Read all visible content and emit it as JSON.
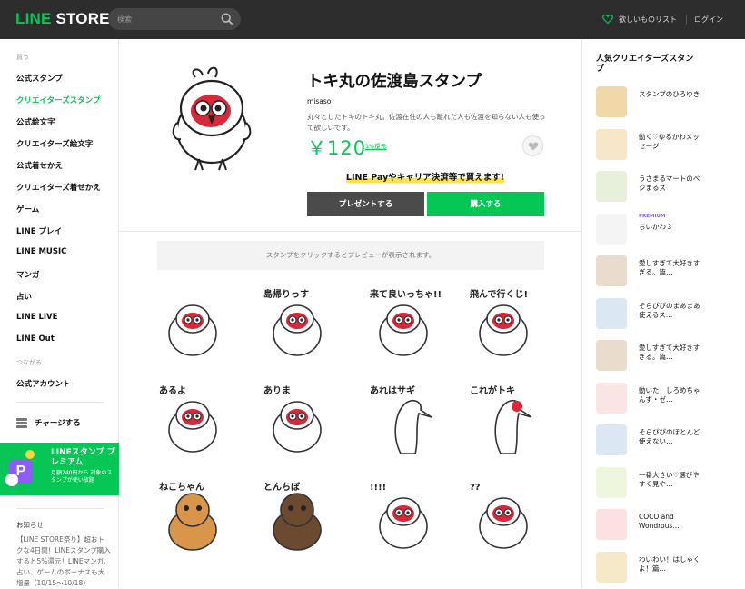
{
  "header": {
    "logo_line": "LINE",
    "logo_store": "STORE",
    "search_placeholder": "検索",
    "wishlist": "欲しいものリスト",
    "login": "ログイン"
  },
  "sidebar": {
    "section_buy": "買う",
    "items": [
      {
        "label": "公式スタンプ"
      },
      {
        "label": "クリエイターズスタンプ"
      },
      {
        "label": "公式絵文字"
      },
      {
        "label": "クリエイターズ絵文字"
      },
      {
        "label": "公式着せかえ"
      },
      {
        "label": "クリエイターズ着せかえ"
      },
      {
        "label": "ゲーム"
      },
      {
        "label": "LINE プレイ"
      },
      {
        "label": "LINE MUSIC"
      },
      {
        "label": "マンガ"
      },
      {
        "label": "占い"
      },
      {
        "label": "LINE LIVE"
      },
      {
        "label": "LINE Out"
      }
    ],
    "section_connect": "つながる",
    "official_account": "公式アカウント",
    "charge": "チャージする",
    "premium": {
      "title": "LINEスタンプ プレミアム",
      "desc": "月額240円から 対象のスタンプが使い放題"
    },
    "news_label": "お知らせ",
    "news_text": "【LINE STORE祭り】超おトクな4日間！LINEスタンプ購入すると5%還元！LINEマンガ、占い、ゲームのボーナスも大増量（10/15〜10/18）"
  },
  "product": {
    "title": "トキ丸の佐渡島スタンプ",
    "author": "misaso",
    "description": "丸々としたトキのトキ丸。佐渡在住の人も離れた人も佐渡を知らない人も使って欲しいです。",
    "price": "￥120",
    "points": "1%還元",
    "promo": "LINE Payやキャリア決済等で買えます!",
    "gift_button": "プレゼントする",
    "buy_button": "購入する",
    "preview_note": "スタンプをクリックするとプレビューが表示されます。"
  },
  "stickers": [
    {
      "text": ""
    },
    {
      "text": "島帰りっす"
    },
    {
      "text": "来て良いっちゃ!!"
    },
    {
      "text": "飛んで行くじ!"
    },
    {
      "text": "あるよ"
    },
    {
      "text": "ありま"
    },
    {
      "text": "あれはサギ"
    },
    {
      "text": "これがトキ"
    },
    {
      "text": "ねこちゃん"
    },
    {
      "text": "とんちぼ"
    },
    {
      "text": "!!!!"
    },
    {
      "text": "??"
    }
  ],
  "ranking": {
    "title": "人気クリエイターズスタンプ",
    "items": [
      {
        "name": "スタンプのひろゆき",
        "badge": "",
        "color": "#f0d8a8"
      },
      {
        "name": "動く♡ゆるかわメッセージ",
        "badge": "",
        "color": "#f7e7c9"
      },
      {
        "name": "うさまるマートのベジまるズ",
        "badge": "",
        "color": "#e6f0da"
      },
      {
        "name": "ちいかわ３",
        "badge": "PREMIUM",
        "color": "#f4f4f4"
      },
      {
        "name": "愛しすぎて大好きすぎる。篇…",
        "badge": "",
        "color": "#eadccc"
      },
      {
        "name": "そらぴぴのまあまあ使えるス…",
        "badge": "",
        "color": "#dbe8f4"
      },
      {
        "name": "愛しすぎて大好きすぎる。篇…",
        "badge": "",
        "color": "#eadccc"
      },
      {
        "name": "動いた！しろめちゃんず・ゼ…",
        "badge": "",
        "color": "#fbe4e4"
      },
      {
        "name": "そらぴぴのほとんど使えない…",
        "badge": "",
        "color": "#dbe8f4"
      },
      {
        "name": "一番大きい♡選びやすく見や…",
        "badge": "",
        "color": "#eef7dd"
      },
      {
        "name": "COCO and Wondrous…",
        "badge": "",
        "color": "#fde0e0"
      },
      {
        "name": "わいわい！はしゃくよ！篇…",
        "badge": "",
        "color": "#f6e9c8"
      }
    ]
  },
  "colors": {
    "brand": "#06c755",
    "header_bg": "#2d2d2d",
    "premium": "#8e5cf6"
  }
}
